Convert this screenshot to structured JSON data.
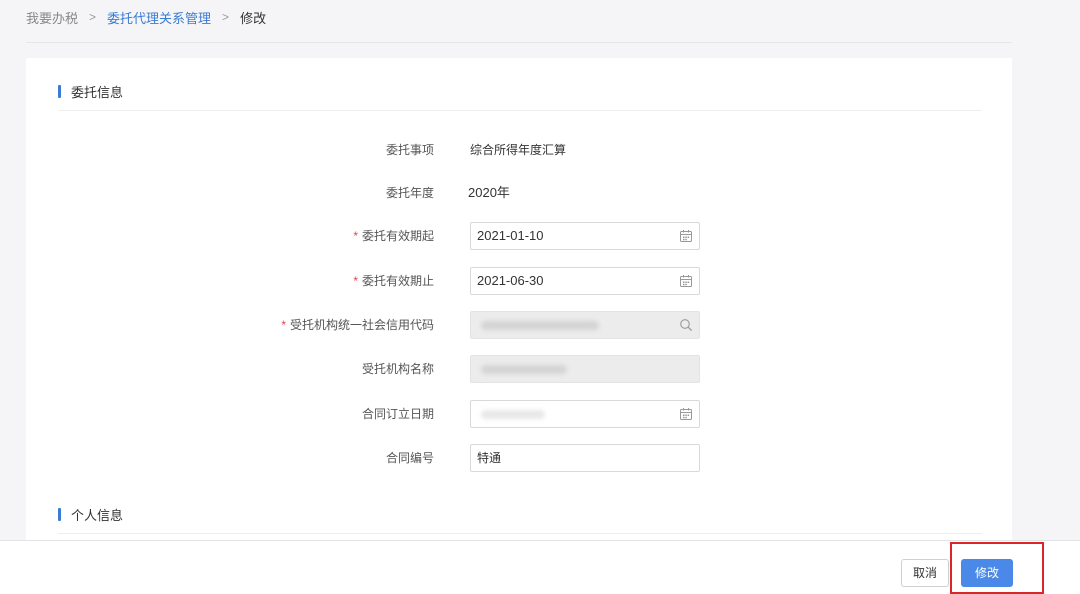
{
  "breadcrumb": {
    "home": "我要办税",
    "section": "委托代理关系管理",
    "current": "修改",
    "separator": ">"
  },
  "sections": {
    "entrust_info": "委托信息",
    "personal_info": "个人信息"
  },
  "form": {
    "matter": {
      "label": "委托事项",
      "value": "综合所得年度汇算"
    },
    "year": {
      "label": "委托年度",
      "value": "2020年"
    },
    "start": {
      "label": "委托有效期起",
      "value": "2021-01-10",
      "required": "*"
    },
    "end": {
      "label": "委托有效期止",
      "value": "2021-06-30",
      "required": "*"
    },
    "credit_code": {
      "label": "受托机构统一社会信用代码",
      "required": "*"
    },
    "org_name": {
      "label": "受托机构名称"
    },
    "contract_date": {
      "label": "合同订立日期"
    },
    "contract_no": {
      "label": "合同编号",
      "value": "特通"
    }
  },
  "actions": {
    "cancel": "取消",
    "submit": "修改"
  },
  "colors": {
    "accent": "#3a7bd5",
    "primary_button": "#4a89e8",
    "required": "#e64340",
    "highlight_box": "#d8262a"
  },
  "icons": {
    "calendar": "calendar-icon",
    "search": "search-icon"
  }
}
